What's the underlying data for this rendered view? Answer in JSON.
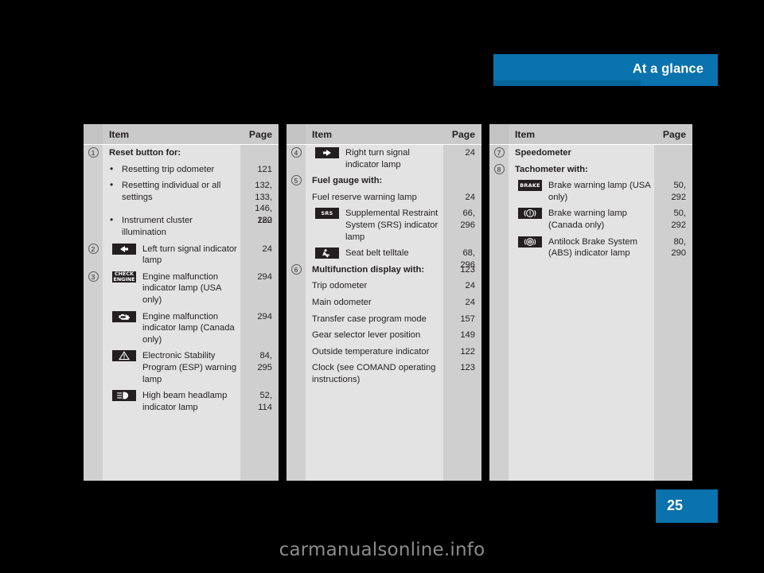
{
  "header": {
    "title": "At a glance",
    "accent": "#0a72ac"
  },
  "page_number": "25",
  "watermark": "carmanualsonline.info",
  "tables": [
    {
      "name": "column-1",
      "headers": {
        "item": "Item",
        "page": "Page"
      },
      "rows": [
        {
          "num": "1",
          "text": "Reset button for:",
          "page": "",
          "style": "bold"
        },
        {
          "num": "",
          "text": "Resetting trip odometer",
          "page": "121",
          "style": "bullet"
        },
        {
          "num": "",
          "text": "Resetting individual or all settings",
          "page": "132,\n133,\n146,\n282",
          "style": "bullet"
        },
        {
          "num": "",
          "text": "Instrument cluster illumination",
          "page": "120",
          "style": "bullet"
        },
        {
          "num": "2",
          "text": "Left turn signal indicator lamp",
          "page": "24",
          "style": "icon",
          "icon": "left-turn-signal-icon"
        },
        {
          "num": "3",
          "text": "Engine malfunction indicator lamp (USA only)",
          "page": "294",
          "style": "icon",
          "icon": "check-engine-text-icon"
        },
        {
          "num": "",
          "text": "Engine malfunction indicator lamp (Canada only)",
          "page": "294",
          "style": "icon",
          "icon": "engine-outline-icon"
        },
        {
          "num": "",
          "text": "Electronic Stability Program (ESP) warning lamp",
          "page": "84,\n295",
          "style": "icon",
          "icon": "warning-triangle-icon"
        },
        {
          "num": "",
          "text": "High beam headlamp indicator lamp",
          "page": "52,\n114",
          "style": "icon",
          "icon": "high-beam-icon"
        }
      ]
    },
    {
      "name": "column-2",
      "headers": {
        "item": "Item",
        "page": "Page"
      },
      "rows": [
        {
          "num": "4",
          "text": "Right turn signal indicator lamp",
          "page": "24",
          "style": "icon",
          "icon": "right-turn-signal-icon"
        },
        {
          "num": "5",
          "text": "Fuel gauge with:",
          "page": "",
          "style": "bold"
        },
        {
          "num": "",
          "text": "Fuel reserve warning lamp",
          "page": "24",
          "style": "plain"
        },
        {
          "num": "",
          "text": "Supplemental Restraint System (SRS) indicator lamp",
          "page": "66,\n296",
          "style": "icon",
          "icon": "srs-text-icon"
        },
        {
          "num": "",
          "text": "Seat belt telltale",
          "page": "68,\n296",
          "style": "icon",
          "icon": "seat-belt-icon"
        },
        {
          "num": "6",
          "text": "Multifunction display with:",
          "page": "123",
          "style": "bold"
        },
        {
          "num": "",
          "text": "Trip odometer",
          "page": "24",
          "style": "plain"
        },
        {
          "num": "",
          "text": "Main odometer",
          "page": "24",
          "style": "plain"
        },
        {
          "num": "",
          "text": "Transfer case program mode",
          "page": "157",
          "style": "plain"
        },
        {
          "num": "",
          "text": "Gear selector lever position",
          "page": "149",
          "style": "plain"
        },
        {
          "num": "",
          "text": "Outside temperature indicator",
          "page": "122",
          "style": "plain"
        },
        {
          "num": "",
          "text": "Clock (see COMAND operating instructions)",
          "page": "123",
          "style": "plain"
        }
      ]
    },
    {
      "name": "column-3",
      "headers": {
        "item": "Item",
        "page": "Page"
      },
      "rows": [
        {
          "num": "7",
          "text": "Speedometer",
          "page": "",
          "style": "bold"
        },
        {
          "num": "8",
          "text": "Tachometer with:",
          "page": "",
          "style": "bold"
        },
        {
          "num": "",
          "text": "Brake warning lamp (USA only)",
          "page": "50,\n292",
          "style": "icon",
          "icon": "brake-text-icon"
        },
        {
          "num": "",
          "text": "Brake warning lamp (Canada only)",
          "page": "50,\n292",
          "style": "icon",
          "icon": "brake-circle-icon"
        },
        {
          "num": "",
          "text": "Antilock Brake System (ABS) indicator lamp",
          "page": "80,\n290",
          "style": "icon",
          "icon": "abs-icon"
        }
      ]
    }
  ]
}
